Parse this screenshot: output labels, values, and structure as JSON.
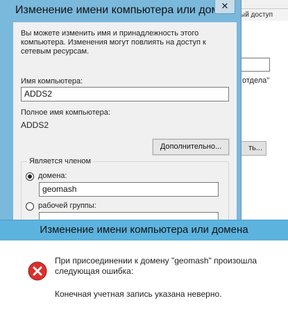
{
  "background_window": {
    "tab_label": "ый доступ",
    "partial_text": "отдела\"",
    "partial_button": "ть..."
  },
  "rename_dialog": {
    "title": "Изменение имени компьютера или доме",
    "close_glyph": "✕",
    "description": "Вы можете изменить имя и принадлежность этого компьютера. Изменения могут повлиять на доступ к сетевым ресурсам.",
    "computer_name_label": "Имя компьютера:",
    "computer_name_value": "ADDS2",
    "full_name_label": "Полное имя компьютера:",
    "full_name_value": "ADDS2",
    "more_button": "Дополнительно...",
    "member_of": {
      "legend": "Является членом",
      "domain_option": "домена:",
      "domain_selected": true,
      "domain_value": "geomash",
      "workgroup_option": "рабочей группы:",
      "workgroup_selected": false
    }
  },
  "error_box": {
    "title": "Изменение имени компьютера или домена",
    "message": "При присоединении к домену \"geomash\" произошла следующая ошибка:",
    "detail": "Конечная учетная запись указана неверно.",
    "icon": "error-icon",
    "icon_color": "#d9302c"
  }
}
